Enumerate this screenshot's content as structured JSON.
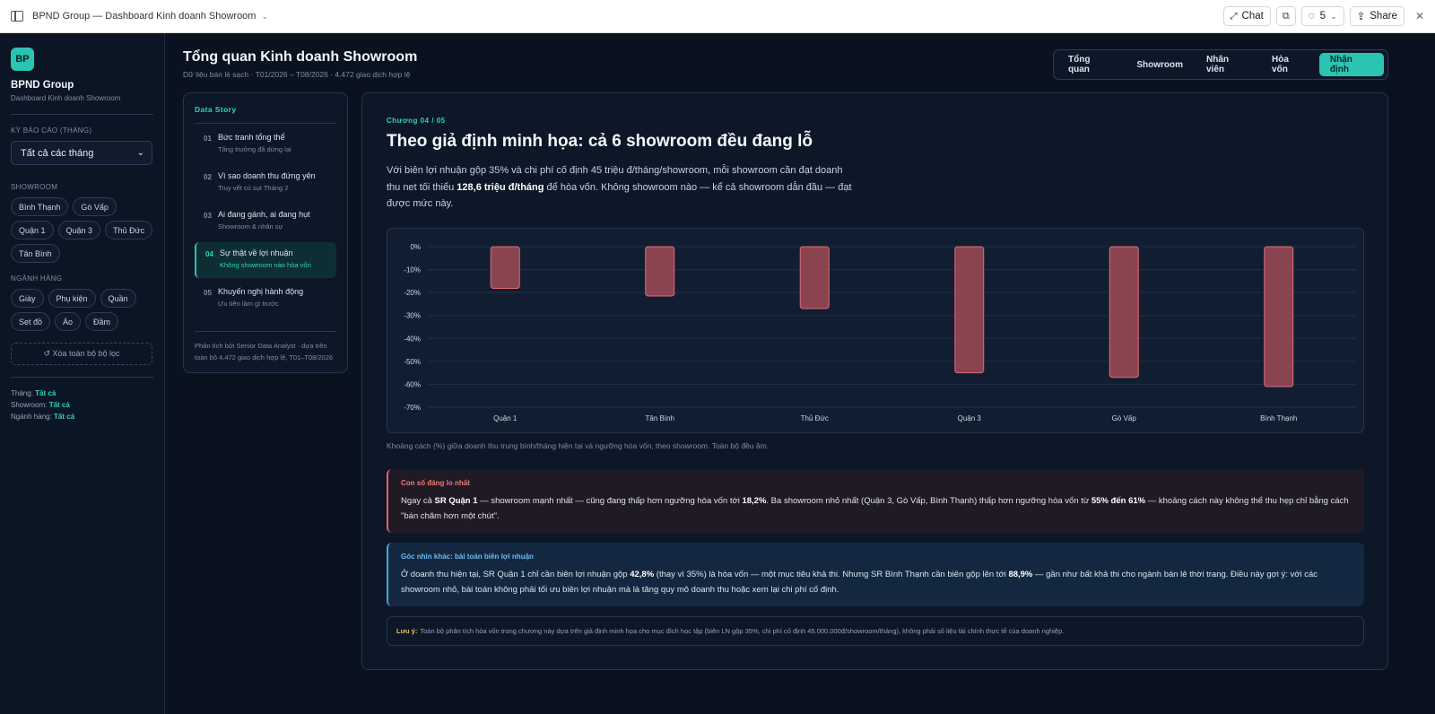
{
  "window": {
    "title": "BPND Group — Dashboard Kinh doanh Showroom",
    "chat_label": "Chat",
    "comment_count": "5",
    "share_label": "Share"
  },
  "sidebar": {
    "logo": "BP",
    "brand": "BPND Group",
    "brand_sub": "Dashboard Kinh doanh Showroom",
    "period_label": "KỲ BÁO CÁO (THÁNG)",
    "period_value": "Tất cả các tháng",
    "showroom_label": "SHOWROOM",
    "showrooms": [
      "Bình Thạnh",
      "Gò Vấp",
      "Quận 1",
      "Quận 3",
      "Thủ Đức",
      "Tân Bình"
    ],
    "category_label": "NGÀNH HÀNG",
    "categories": [
      "Giày",
      "Phụ kiện",
      "Quần",
      "Set đồ",
      "Áo",
      "Đầm"
    ],
    "clear_label": "↺ Xóa toàn bộ bộ lọc",
    "summary": [
      {
        "key": "Tháng: ",
        "value": "Tất cả"
      },
      {
        "key": "Showroom: ",
        "value": "Tất cả"
      },
      {
        "key": "Ngành hàng: ",
        "value": "Tất cả"
      }
    ]
  },
  "header": {
    "title": "Tổng quan Kinh doanh Showroom",
    "subtitle": "Dữ liệu bán lẻ sạch · T01/2026 – T08/2026 · 4.472 giao dịch hợp lệ",
    "tabs": [
      "Tổng quan",
      "Showroom",
      "Nhân viên",
      "Hòa vốn",
      "Nhận định"
    ],
    "active_tab": "Nhận định"
  },
  "story": {
    "title": "Data Story",
    "steps": [
      {
        "num": "01",
        "title": "Bức tranh tổng thể",
        "sub": "Tăng trưởng đã dừng lại"
      },
      {
        "num": "02",
        "title": "Vì sao doanh thu đứng yên",
        "sub": "Truy vết cú sụt Tháng 2"
      },
      {
        "num": "03",
        "title": "Ai đang gánh, ai đang hụt",
        "sub": "Showroom & nhân sự"
      },
      {
        "num": "04",
        "title": "Sự thật về lợi nhuận",
        "sub": "Không showroom nào hòa vốn"
      },
      {
        "num": "05",
        "title": "Khuyến nghị hành động",
        "sub": "Ưu tiên làm gì trước"
      }
    ],
    "active_step": 3,
    "footer": "Phân tích bởi Senior Data Analyst · dựa trên toàn bộ 4.472 giao dịch hợp lệ, T01–T08/2026"
  },
  "main": {
    "chapter": "Chương 04 / 05",
    "headline": "Theo giả định minh họa: cả 6 showroom đều đang lỗ",
    "lead_parts": [
      "Với biên lợi nhuận gộp 35% và chi phí cố định 45 triệu đ/tháng/showroom, mỗi showroom cần đạt doanh thu net tối thiểu ",
      "128,6 triệu đ/tháng",
      " để hòa vốn. Không showroom nào — kể cả showroom dẫn đầu — đạt được mức này."
    ],
    "chart_note": "Khoảng cách (%) giữa doanh thu trung bình/tháng hiện tại và ngưỡng hòa vốn, theo showroom. Toàn bộ đều âm.",
    "callout_red": {
      "title": "Con số đáng lo nhất",
      "parts": [
        "Ngay cả ",
        "SR Quận 1",
        " — showroom mạnh nhất — cũng đang thấp hơn ngưỡng hòa vốn tới ",
        "18,2%",
        ". Ba showroom nhỏ nhất (Quận 3, Gò Vấp, Bình Thạnh) thấp hơn ngưỡng hòa vốn từ ",
        "55% đến 61%",
        " — khoảng cách này không thể thu hẹp chỉ bằng cách \"bán chăm hơn một chút\"."
      ]
    },
    "callout_blue": {
      "title": "Góc nhìn khác: bài toán biên lợi nhuận",
      "parts": [
        "Ở doanh thu hiện tại, SR Quận 1 chỉ cần biên lợi nhuận gộp ",
        "42,8%",
        " (thay vì 35%) là hòa vốn — một mục tiêu khả thi. Nhưng SR Bình Thạnh cần biên gộp lên tới ",
        "88,9%",
        " — gần như bất khả thi cho ngành bán lẻ thời trang. Điều này gợi ý: với các showroom nhỏ, bài toán không phải tối ưu biên lợi nhuận mà là tăng quy mô doanh thu hoặc xem lại chi phí cố định."
      ]
    },
    "note_label": "Lưu ý:",
    "note_text": "Toàn bộ phân tích hòa vốn trong chương này dựa trên giả định minh họa cho mục đích học tập (biên LN gộp 35%, chi phí cố định 45.000.000đ/showroom/tháng), không phải số liệu tài chính thực tế của doanh nghiệp."
  },
  "chart_data": {
    "type": "bar",
    "categories": [
      "Quận 1",
      "Tân Bình",
      "Thủ Đức",
      "Quận 3",
      "Gò Vấp",
      "Bình Thạnh"
    ],
    "values": [
      -18.2,
      -21.5,
      -27,
      -55,
      -57,
      -61
    ],
    "ylim": [
      -70,
      0
    ],
    "yticks": [
      "0%",
      "-10%",
      "-20%",
      "-30%",
      "-40%",
      "-50%",
      "-60%",
      "-70%"
    ],
    "grid": true,
    "bar_color": "#8a4450",
    "bar_border": "#e06a78"
  }
}
